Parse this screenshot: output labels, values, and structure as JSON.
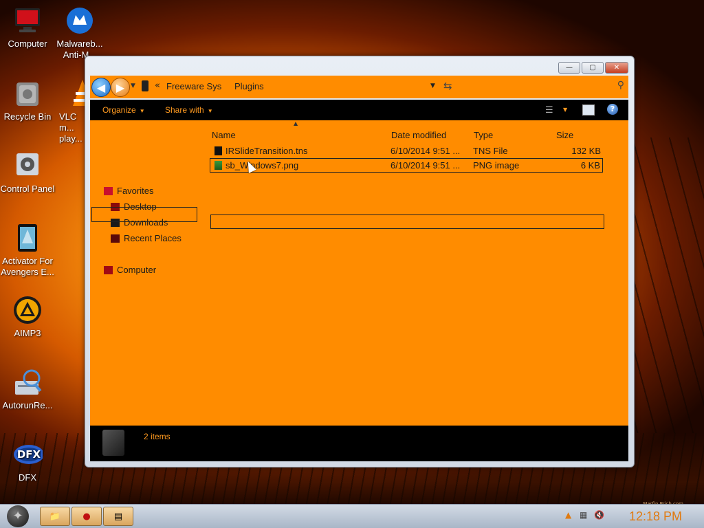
{
  "desktop": {
    "icons": [
      {
        "label": "Computer",
        "icon": "computer-icon"
      },
      {
        "label": "Malwareb... Anti-M...",
        "icon": "malwarebytes-icon"
      },
      {
        "label": "Recycle Bin",
        "icon": "recycle-bin-icon"
      },
      {
        "label": "VLC m... play...",
        "icon": "vlc-icon"
      },
      {
        "label": "Control Panel",
        "icon": "control-panel-icon"
      },
      {
        "label": "Activator For Avengers E...",
        "icon": "activator-icon"
      },
      {
        "label": "AIMP3",
        "icon": "aimp-icon"
      },
      {
        "label": "AutorunRe...",
        "icon": "autorun-icon"
      },
      {
        "label": "DFX",
        "icon": "dfx-icon"
      }
    ],
    "watermark": "Marfin Prich.com"
  },
  "window": {
    "controls": {
      "minimize": "—",
      "maximize": "▢",
      "close": "✕"
    },
    "address": {
      "breadcrumbs": [
        "Freeware Sys",
        "Plugins"
      ],
      "chevron": "«"
    },
    "toolbar": {
      "organize": "Organize",
      "share_with": "Share with"
    },
    "nav": {
      "favorites": "Favorites",
      "desktop": "Desktop",
      "downloads": "Downloads",
      "recent_places": "Recent Places",
      "computer": "Computer"
    },
    "columns": {
      "name": "Name",
      "date": "Date modified",
      "type": "Type",
      "size": "Size"
    },
    "files": [
      {
        "name": "IRSlideTransition.tns",
        "date": "6/10/2014 9:51 ...",
        "type": "TNS File",
        "size": "132 KB"
      },
      {
        "name": "sb_Windows7.png",
        "date": "6/10/2014 9:51 ...",
        "type": "PNG image",
        "size": "6 KB"
      }
    ],
    "status": {
      "item_count": "2 items"
    }
  },
  "taskbar": {
    "clock": "12:18 PM"
  },
  "colors": {
    "accent": "#ff8c00",
    "toolbar_bg": "#000000",
    "toolbar_text": "#ff9a20"
  }
}
